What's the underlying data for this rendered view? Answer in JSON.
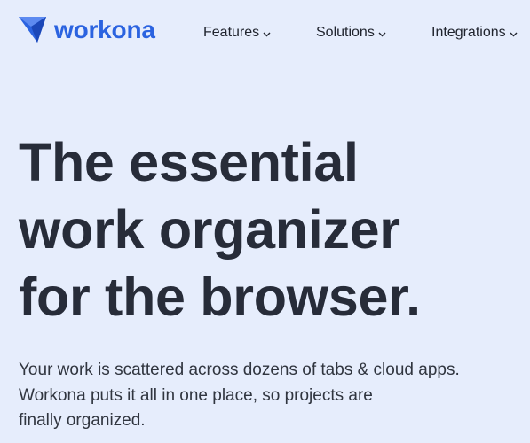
{
  "brand": {
    "name": "workona",
    "color": "#2b63e0"
  },
  "nav": {
    "items": [
      {
        "label": "Features",
        "icon": "chevron-down-icon"
      },
      {
        "label": "Solutions",
        "icon": "chevron-down-icon"
      },
      {
        "label": "Integrations",
        "icon": "chevron-down-icon"
      }
    ]
  },
  "hero": {
    "title_lines": [
      "The essential",
      "work organizer",
      "for the browser."
    ],
    "subtitle_lines": [
      "Your work is scattered across dozens of tabs & cloud apps.",
      "Workona puts it all in one place, so projects are",
      "finally organized."
    ]
  },
  "colors": {
    "background": "#e6edfc",
    "heading": "#272c39",
    "text": "#30353f"
  }
}
